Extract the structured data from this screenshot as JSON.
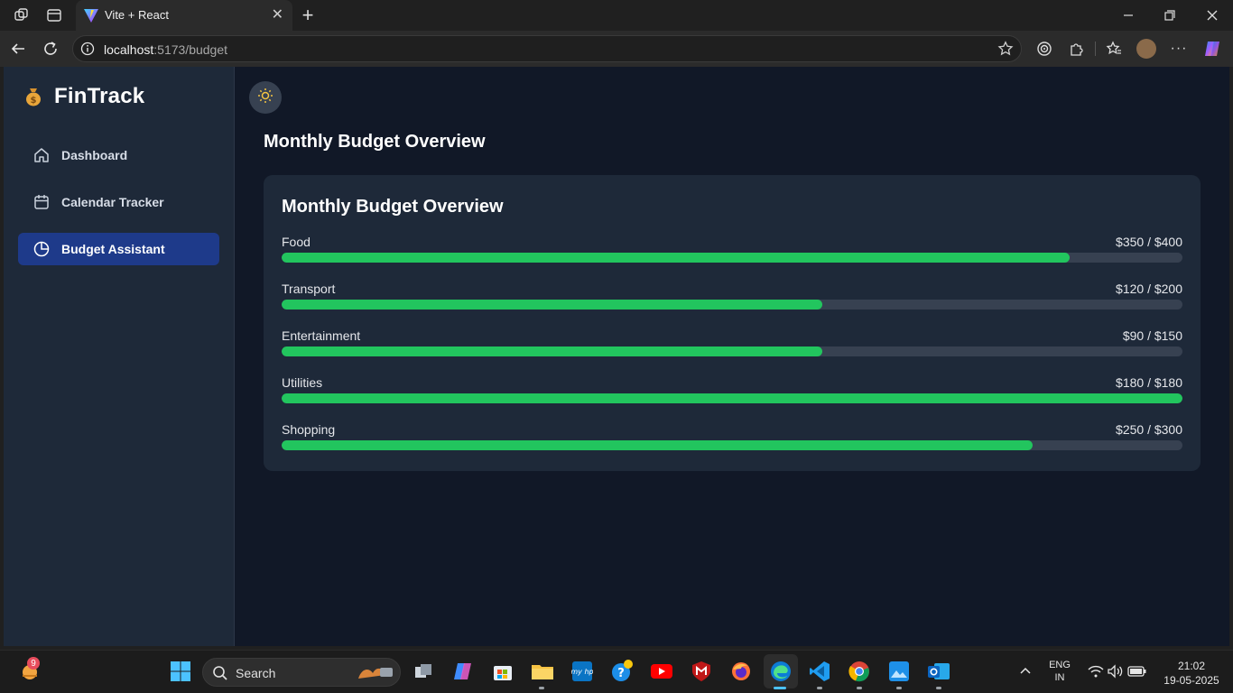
{
  "browser": {
    "tab_title": "Vite + React",
    "url_host": "localhost",
    "url_rest": ":5173/budget",
    "tab_close": "✕",
    "new_tab": "+"
  },
  "app": {
    "brand": {
      "icon": "money-bag-icon",
      "title": "FinTrack"
    },
    "nav": [
      {
        "label": "Dashboard",
        "icon": "home-icon",
        "active": false
      },
      {
        "label": "Calendar Tracker",
        "icon": "calendar-icon",
        "active": false
      },
      {
        "label": "Budget Assistant",
        "icon": "pie-chart-icon",
        "active": true
      }
    ],
    "theme_toggle_icon": "sun-icon",
    "page_title": "Monthly Budget Overview",
    "card": {
      "title": "Monthly Budget Overview",
      "budgets": [
        {
          "name": "Food",
          "amount": "$350 / $400",
          "spent": 350,
          "limit": 400
        },
        {
          "name": "Transport",
          "amount": "$120 / $200",
          "spent": 120,
          "limit": 200
        },
        {
          "name": "Entertainment",
          "amount": "$90 / $150",
          "spent": 90,
          "limit": 150
        },
        {
          "name": "Utilities",
          "amount": "$180 / $180",
          "spent": 180,
          "limit": 180
        },
        {
          "name": "Shopping",
          "amount": "$250 / $300",
          "spent": 250,
          "limit": 300
        }
      ],
      "fill_color": "#22c55e",
      "track_color": "#374151"
    }
  },
  "taskbar": {
    "weather_badge": "9",
    "search_label": "Search",
    "lang_top": "ENG",
    "lang_bottom": "IN",
    "time": "21:02",
    "date": "19-05-2025"
  }
}
